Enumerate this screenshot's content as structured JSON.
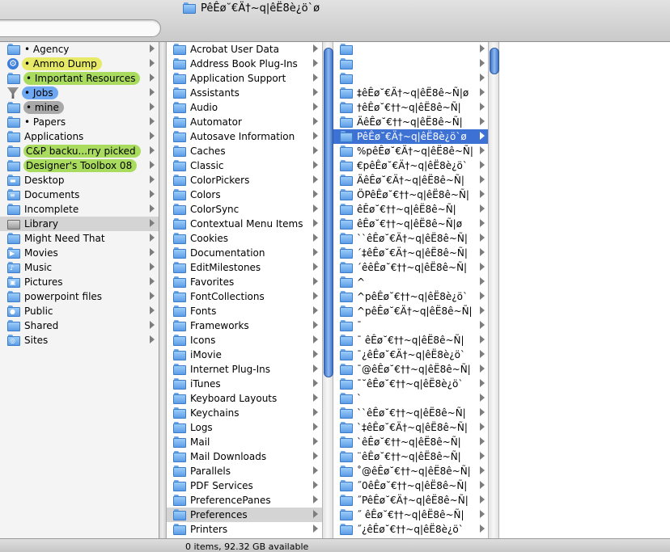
{
  "window": {
    "title": "PêÊø˘€Ä†~q|êË8è¿ö`ø"
  },
  "status": {
    "text": "0 items, 92.32 GB available"
  },
  "sidebar": {
    "items": [
      {
        "label": "• Agency",
        "icon": "folder-icon",
        "hl": ""
      },
      {
        "label": "• Ammo Dump",
        "icon": "smart-folder-gear-icon",
        "hl": "#e6ea67"
      },
      {
        "label": "• Important Resources",
        "icon": "folder-icon",
        "hl": "#a9dc5e"
      },
      {
        "label": "• Jobs",
        "icon": "filter-icon",
        "hl": "#6fa8f2"
      },
      {
        "label": "• mine",
        "icon": "folder-icon",
        "hl": "#a8a8a8"
      },
      {
        "label": "• Papers",
        "icon": "folder-icon",
        "hl": ""
      },
      {
        "label": "Applications",
        "icon": "folder-icon",
        "hl": ""
      },
      {
        "label": "C&P backu...rry picked",
        "icon": "folder-icon",
        "hl": "#a9dc5e"
      },
      {
        "label": "Designer's Toolbox 08",
        "icon": "folder-icon",
        "hl": "#a9dc5e"
      },
      {
        "label": "Desktop",
        "icon": "desktop-folder-icon",
        "hl": ""
      },
      {
        "label": "Documents",
        "icon": "documents-folder-icon",
        "hl": ""
      },
      {
        "label": "Incomplete",
        "icon": "folder-icon",
        "hl": ""
      },
      {
        "label": "Library",
        "icon": "library-folder-icon",
        "hl": "",
        "selected": true
      },
      {
        "label": "Might Need That",
        "icon": "folder-icon",
        "hl": ""
      },
      {
        "label": "Movies",
        "icon": "movies-folder-icon",
        "hl": ""
      },
      {
        "label": "Music",
        "icon": "music-folder-icon",
        "hl": ""
      },
      {
        "label": "Pictures",
        "icon": "pictures-folder-icon",
        "hl": ""
      },
      {
        "label": "powerpoint files",
        "icon": "folder-icon",
        "hl": ""
      },
      {
        "label": "Public",
        "icon": "public-folder-icon",
        "hl": ""
      },
      {
        "label": "Shared",
        "icon": "folder-icon",
        "hl": ""
      },
      {
        "label": "Sites",
        "icon": "sites-folder-icon",
        "hl": ""
      }
    ]
  },
  "column2": {
    "items": [
      "Acrobat User Data",
      "Address Book Plug-Ins",
      "Application Support",
      "Assistants",
      "Audio",
      "Automator",
      "Autosave Information",
      "Caches",
      "Classic",
      "ColorPickers",
      "Colors",
      "ColorSync",
      "Contextual Menu Items",
      "Cookies",
      "Documentation",
      "EditMilestones",
      "Favorites",
      "FontCollections",
      "Fonts",
      "Frameworks",
      "Icons",
      "iMovie",
      "Internet Plug-Ins",
      "iTunes",
      "Keyboard Layouts",
      "Keychains",
      "Logs",
      "Mail",
      "Mail Downloads",
      "Parallels",
      "PDF Services",
      "PreferencePanes",
      "Preferences",
      "Printers"
    ],
    "selected_index": 32
  },
  "column3": {
    "items": [
      "",
      "",
      "",
      "‡êÊø˘€Ä†~q|êË8ê~Ñ|ø",
      "†êÊø˘€††~q|êË8ê~Ñ|",
      "ÄêÊø˘€††~q|êË8ê~Ñ|",
      "PêÊø˘€Ä†~q|êË8è¿ö`ø",
      "%pêÊø˘€Ä†~q|êË8ê~Ñ|",
      "€pêÊø˘€Ä†~q|êË8è¿ö`",
      "ÄêÊø˘€Ä†~q|êË8ê~Ñ|",
      "ÖPêÊø˘€††~q|êË8ê~Ñ|",
      "êÊø˘€††~q|êË8ê~Ñ|",
      "êÊø˘€††~q|êË8ê~Ñ|ø",
      "``êÊø˘€Ä†~q|êË8ê~Ñ|",
      "´‡êÊø˘€Ä†~q|êË8ê~Ñ|",
      "´êêÊø˘€††~q|êË8ê~Ñ|",
      "^",
      "^pêÊø˘€††~q|êË8è¿ö`",
      "^pêÊø˘€Ä†~q|êË8ê~Ñ|",
      "¯",
      "¯ êÊø˘€††~q|êË8ê~Ñ|",
      "¯¿êÊø˘€Ä†~q|êË8è¿ö`",
      "¯@êÊø˘€††~q|êË8ê~Ñ|",
      "¯˘êÊø˘€††~q|êË8è¿ö`",
      "`",
      "``êÊø˘€††~q|êË8ê~Ñ|",
      "`‡êÊø˘€Ä†~q|êË8ê~Ñ|",
      "`êÊø˘€††~q|êË8ê~Ñ|",
      "¨êÊø˘€††~q|êË8ê~Ñ|",
      "˚@êÊø˘€††~q|êË8ê~Ñ|",
      "˝0êÊø˘€††~q|êË8ê~Ñ|",
      "˝PêÊø˘€Ä†~q|êË8ê~Ñ|",
      "˝ êÊø˘€††~q|êË8ê~Ñ|",
      "˝¿êÊø˘€††~q|êË8è¿ö`"
    ],
    "selected_index": 6
  }
}
